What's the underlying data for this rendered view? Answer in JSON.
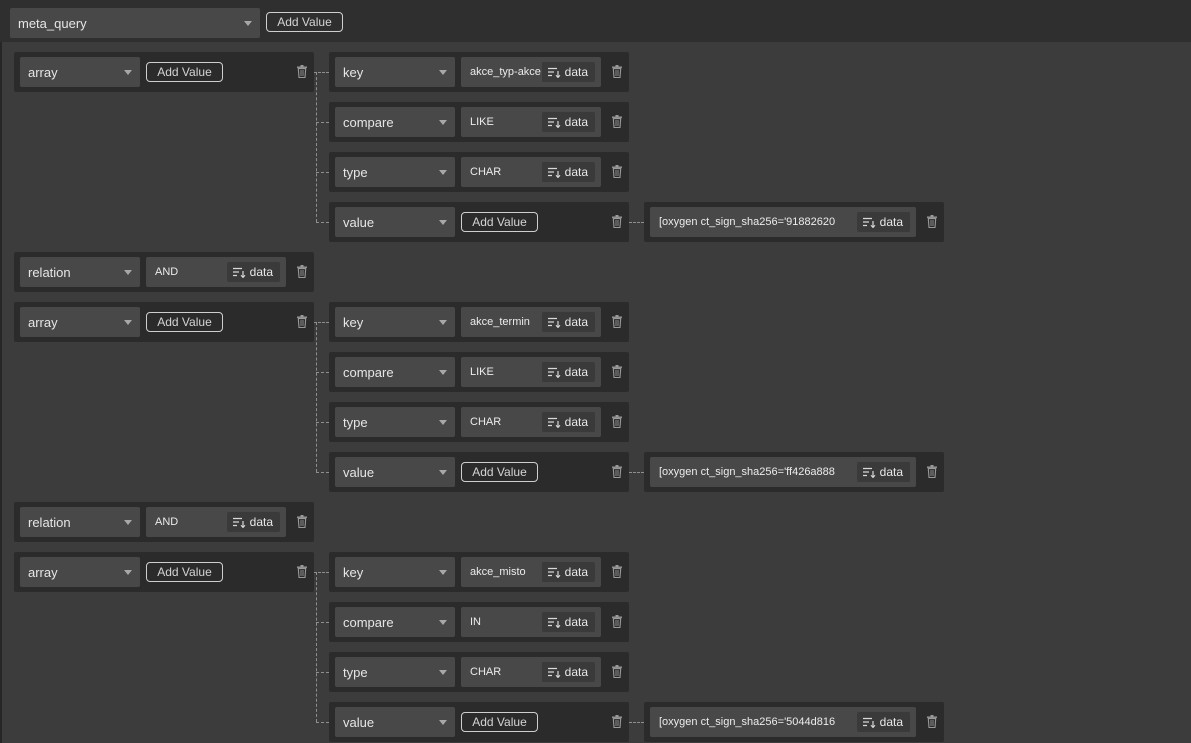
{
  "root": {
    "label": "meta_query",
    "add_label": "Add Value"
  },
  "data_label": "data",
  "groups": [
    {
      "array": {
        "label": "array",
        "add_label": "Add Value"
      },
      "rows": [
        {
          "label": "key",
          "value": "akce_typ-akce"
        },
        {
          "label": "compare",
          "value": "LIKE"
        },
        {
          "label": "type",
          "value": "CHAR"
        },
        {
          "label": "value",
          "add_label": "Add Value",
          "sub_value": "[oxygen ct_sign_sha256='91882620"
        }
      ]
    },
    {
      "array": {
        "label": "array",
        "add_label": "Add Value"
      },
      "rows": [
        {
          "label": "key",
          "value": "akce_termin"
        },
        {
          "label": "compare",
          "value": "LIKE"
        },
        {
          "label": "type",
          "value": "CHAR"
        },
        {
          "label": "value",
          "add_label": "Add Value",
          "sub_value": "[oxygen ct_sign_sha256='ff426a888"
        }
      ]
    },
    {
      "array": {
        "label": "array",
        "add_label": "Add Value"
      },
      "rows": [
        {
          "label": "key",
          "value": "akce_misto"
        },
        {
          "label": "compare",
          "value": "IN"
        },
        {
          "label": "type",
          "value": "CHAR"
        },
        {
          "label": "value",
          "add_label": "Add Value",
          "sub_value": "[oxygen ct_sign_sha256='5044d816"
        }
      ]
    }
  ],
  "relations": [
    {
      "label": "relation",
      "value": "AND"
    },
    {
      "label": "relation",
      "value": "AND"
    }
  ],
  "icons": {
    "delete": "trash-icon",
    "data": "data-list-icon",
    "dropdown": "chevron-down-icon"
  }
}
